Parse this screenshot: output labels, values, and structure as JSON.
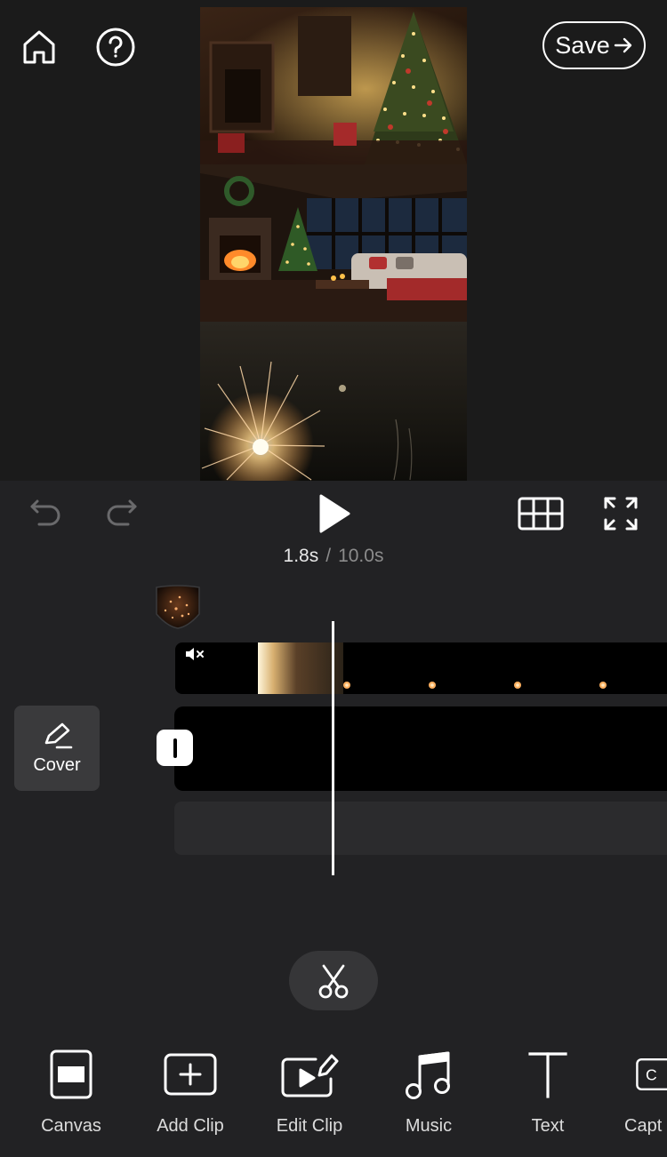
{
  "header": {
    "home_icon": "home-icon",
    "help_icon": "question-circle-icon",
    "save_label": "Save",
    "save_icon": "arrow-right-icon"
  },
  "preview": {
    "panels": [
      {
        "name": "christmas-tree-fireplace-photo"
      },
      {
        "name": "cozy-living-room-christmas-photo"
      },
      {
        "name": "fireworks-sparkler-clip"
      }
    ]
  },
  "playback": {
    "undo_icon": "undo-icon",
    "redo_icon": "redo-icon",
    "play_icon": "play-icon",
    "grid_icon": "grid-icon",
    "fullscreen_icon": "fullscreen-icon",
    "current_time": "1.8s",
    "separator": "/",
    "total_time": "10.0s"
  },
  "timeline": {
    "cover_label": "Cover",
    "cover_icon": "pencil-icon",
    "mute_icon": "mute-icon",
    "split_icon": "scissors-icon"
  },
  "toolbar": {
    "items": [
      {
        "label": "Canvas",
        "icon": "canvas-icon"
      },
      {
        "label": "Add Clip",
        "icon": "add-clip-icon"
      },
      {
        "label": "Edit Clip",
        "icon": "edit-clip-icon"
      },
      {
        "label": "Music",
        "icon": "music-icon"
      },
      {
        "label": "Text",
        "icon": "text-icon"
      },
      {
        "label": "Capt",
        "icon": "captions-icon"
      }
    ]
  },
  "colors": {
    "background": "#1c1c1e",
    "editor_background": "#222224",
    "track": "#000000",
    "accent_white": "#ffffff",
    "muted_text": "#8c8c8c"
  }
}
